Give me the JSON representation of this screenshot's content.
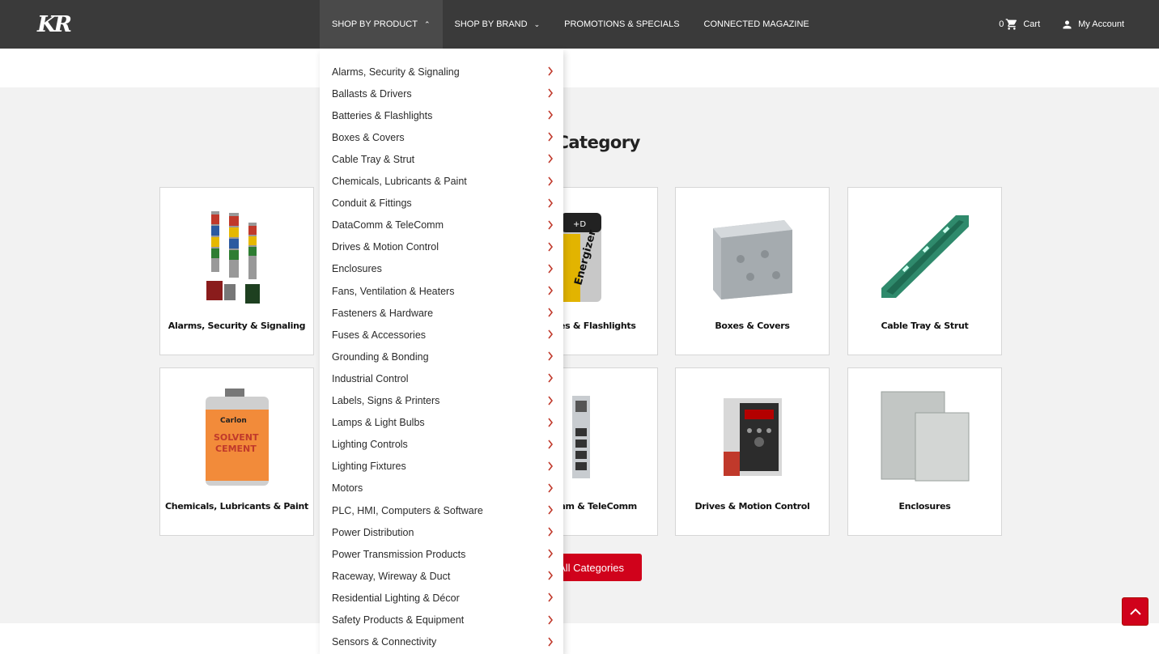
{
  "header": {
    "logo": "KR",
    "nav": [
      {
        "label": "SHOP BY PRODUCT",
        "chevron": "up"
      },
      {
        "label": "SHOP BY BRAND",
        "chevron": "down"
      },
      {
        "label": "PROMOTIONS & SPECIALS"
      },
      {
        "label": "CONNECTED MAGAZINE"
      }
    ],
    "cart_count": "0",
    "cart_label": "Cart",
    "account_label": "My Account"
  },
  "main": {
    "section_title": "Top Category",
    "cards": [
      {
        "label": "Alarms, Security & Signaling",
        "icon": "signal-tower-image"
      },
      {
        "label": "es & Flashlights",
        "icon": "battery-image"
      },
      {
        "label": "Boxes & Covers",
        "icon": "metal-box-image"
      },
      {
        "label": "Cable Tray & Strut",
        "icon": "strut-channel-image"
      },
      {
        "label": "Chemicals, Lubricants & Paint",
        "icon": "solvent-can-image"
      },
      {
        "label": "nm & TeleComm",
        "icon": "network-switch-image"
      },
      {
        "label": "Drives & Motion Control",
        "icon": "vfd-drive-image"
      },
      {
        "label": "Enclosures",
        "icon": "enclosure-image"
      }
    ],
    "all_button": "All Categories"
  },
  "dropdown": {
    "items": [
      "Alarms, Security & Signaling",
      "Ballasts & Drivers",
      "Batteries & Flashlights",
      "Boxes & Covers",
      "Cable Tray & Strut",
      "Chemicals, Lubricants & Paint",
      "Conduit & Fittings",
      "DataComm & TeleComm",
      "Drives & Motion Control",
      "Enclosures",
      "Fans, Ventilation & Heaters",
      "Fasteners & Hardware",
      "Fuses & Accessories",
      "Grounding & Bonding",
      "Industrial Control",
      "Labels, Signs & Printers",
      "Lamps & Light Bulbs",
      "Lighting Controls",
      "Lighting Fixtures",
      "Motors",
      "PLC, HMI, Computers & Software",
      "Power Distribution",
      "Power Transmission Products",
      "Raceway, Wireway & Duct",
      "Residential Lighting & Décor",
      "Safety Products & Equipment",
      "Sensors & Connectivity"
    ]
  },
  "colors": {
    "header_bg": "#3a3a3a",
    "accent_red": "#d0021b",
    "arrow_red": "#c0392b"
  }
}
